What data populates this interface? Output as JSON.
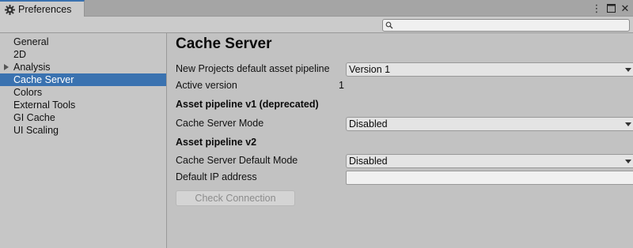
{
  "window": {
    "tab_title": "Preferences",
    "controls": {
      "more": "⋮",
      "maximize": "□",
      "close": "✕"
    }
  },
  "search": {
    "placeholder": "",
    "value": ""
  },
  "sidebar": {
    "items": [
      {
        "label": "General",
        "selected": false,
        "expandable": false
      },
      {
        "label": "2D",
        "selected": false,
        "expandable": false
      },
      {
        "label": "Analysis",
        "selected": false,
        "expandable": true
      },
      {
        "label": "Cache Server",
        "selected": true,
        "expandable": false
      },
      {
        "label": "Colors",
        "selected": false,
        "expandable": false
      },
      {
        "label": "External Tools",
        "selected": false,
        "expandable": false
      },
      {
        "label": "GI Cache",
        "selected": false,
        "expandable": false
      },
      {
        "label": "UI Scaling",
        "selected": false,
        "expandable": false
      }
    ]
  },
  "main": {
    "title": "Cache Server",
    "pipeline_label": "New Projects default asset pipeline",
    "pipeline_value": "Version 1",
    "active_version_label": "Active version",
    "active_version_value": "1",
    "v1_header": "Asset pipeline v1 (deprecated)",
    "v1_mode_label": "Cache Server Mode",
    "v1_mode_value": "Disabled",
    "v2_header": "Asset pipeline v2",
    "v2_mode_label": "Cache Server Default Mode",
    "v2_mode_value": "Disabled",
    "ip_label": "Default IP address",
    "ip_value": "",
    "check_button": "Check Connection"
  },
  "colors": {
    "accent": "#3a72b0",
    "panel": "#c2c2c2",
    "sidebar": "#c6c6c6"
  }
}
